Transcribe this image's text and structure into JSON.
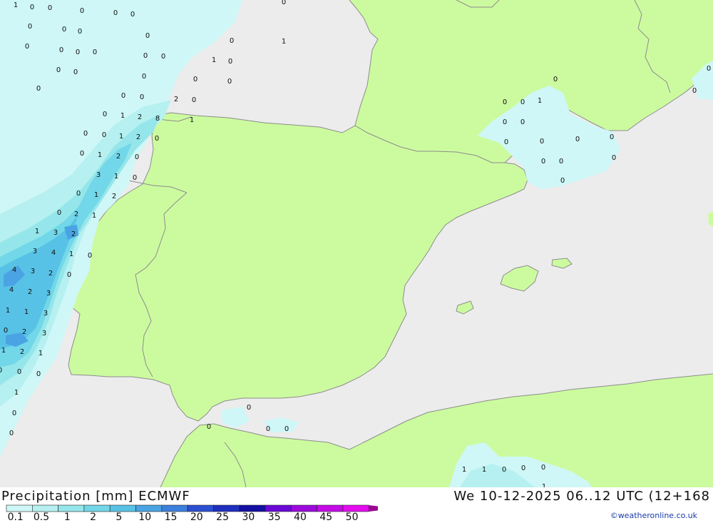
{
  "title": {
    "left": "Precipitation [mm] ECMWF",
    "right": "We 10-12-2025 06..12 UTC (12+168"
  },
  "credit": "©weatheronline.co.uk",
  "colors": {
    "sea": "#ececec",
    "land": "#ccfb9f",
    "border": "#8c8c8c"
  },
  "legend": {
    "colors": [
      "#cff7f7",
      "#b6f0f0",
      "#95e6ea",
      "#72d7e8",
      "#58c2e6",
      "#4aa4e3",
      "#3d7fdd",
      "#2b4fd0",
      "#1e2fc0",
      "#1310a3",
      "#6a08d8",
      "#9b0adc",
      "#c50ae8",
      "#e40cef",
      "#c80fb8",
      "#9a0893"
    ],
    "labels": [
      "0.1",
      "0.5",
      "1",
      "2",
      "5",
      "10",
      "15",
      "20",
      "25",
      "30",
      "35",
      "40",
      "45",
      "50"
    ]
  },
  "map_values": [
    [
      "1",
      22,
      6
    ],
    [
      "0",
      45,
      9
    ],
    [
      "0",
      70,
      10
    ],
    [
      "0",
      115,
      14
    ],
    [
      "0",
      162,
      17
    ],
    [
      "0",
      186,
      19
    ],
    [
      "0",
      398,
      2
    ],
    [
      "0",
      42,
      36
    ],
    [
      "0",
      90,
      40
    ],
    [
      "0",
      112,
      43
    ],
    [
      "0",
      207,
      49
    ],
    [
      "0",
      38,
      64
    ],
    [
      "0",
      86,
      69
    ],
    [
      "0",
      109,
      72
    ],
    [
      "0",
      133,
      72
    ],
    [
      "0",
      204,
      77
    ],
    [
      "0",
      229,
      78
    ],
    [
      "1",
      398,
      57
    ],
    [
      "0",
      325,
      56
    ],
    [
      "1",
      300,
      83
    ],
    [
      "0",
      323,
      85
    ],
    [
      "0",
      82,
      97
    ],
    [
      "0",
      106,
      100
    ],
    [
      "0",
      202,
      106
    ],
    [
      "0",
      274,
      110
    ],
    [
      "0",
      322,
      113
    ],
    [
      "0",
      54,
      123
    ],
    [
      "0",
      173,
      133
    ],
    [
      "0",
      199,
      135
    ],
    [
      "2",
      247,
      138
    ],
    [
      "0",
      272,
      139
    ],
    [
      "0",
      147,
      159
    ],
    [
      "1",
      172,
      161
    ],
    [
      "2",
      196,
      163
    ],
    [
      "8",
      221,
      165
    ],
    [
      "1",
      269,
      167
    ],
    [
      "0",
      120,
      186
    ],
    [
      "0",
      146,
      188
    ],
    [
      "1",
      170,
      190
    ],
    [
      "2",
      194,
      191
    ],
    [
      "0",
      220,
      193
    ],
    [
      "0",
      115,
      214
    ],
    [
      "1",
      140,
      216
    ],
    [
      "2",
      166,
      218
    ],
    [
      "0",
      192,
      219
    ],
    [
      "3",
      138,
      244
    ],
    [
      "1",
      163,
      246
    ],
    [
      "0",
      189,
      248
    ],
    [
      "0",
      110,
      270
    ],
    [
      "1",
      135,
      272
    ],
    [
      "2",
      160,
      274
    ],
    [
      "0",
      83,
      297
    ],
    [
      "2",
      107,
      299
    ],
    [
      "1",
      132,
      301
    ],
    [
      "1",
      52,
      323
    ],
    [
      "3",
      78,
      325
    ],
    [
      "2",
      103,
      327
    ],
    [
      "3",
      49,
      351
    ],
    [
      "4",
      75,
      353
    ],
    [
      "1",
      100,
      355
    ],
    [
      "0",
      126,
      357
    ],
    [
      "4",
      20,
      377
    ],
    [
      "3",
      46,
      379
    ],
    [
      "2",
      71,
      382
    ],
    [
      "0",
      97,
      384
    ],
    [
      "4",
      16,
      405
    ],
    [
      "2",
      42,
      408
    ],
    [
      "3",
      68,
      410
    ],
    [
      "1",
      11,
      434
    ],
    [
      "1",
      37,
      436
    ],
    [
      "3",
      64,
      438
    ],
    [
      "0",
      8,
      462
    ],
    [
      "2",
      34,
      464
    ],
    [
      "3",
      62,
      466
    ],
    [
      "1",
      5,
      490
    ],
    [
      "2",
      31,
      492
    ],
    [
      "1",
      57,
      494
    ],
    [
      "0",
      0,
      518
    ],
    [
      "0",
      27,
      520
    ],
    [
      "0",
      54,
      523
    ],
    [
      "1",
      23,
      549
    ],
    [
      "0",
      20,
      578
    ],
    [
      "0",
      16,
      606
    ],
    [
      "0",
      349,
      570
    ],
    [
      "0",
      293,
      597
    ],
    [
      "0",
      376,
      600
    ],
    [
      "0",
      402,
      600
    ],
    [
      "0",
      779,
      110
    ],
    [
      "0",
      708,
      142
    ],
    [
      "0",
      733,
      142
    ],
    [
      "1",
      757,
      140
    ],
    [
      "0",
      708,
      170
    ],
    [
      "0",
      733,
      170
    ],
    [
      "0",
      710,
      198
    ],
    [
      "0",
      760,
      197
    ],
    [
      "0",
      810,
      194
    ],
    [
      "0",
      858,
      191
    ],
    [
      "0",
      762,
      225
    ],
    [
      "0",
      787,
      225
    ],
    [
      "0",
      861,
      220
    ],
    [
      "0",
      789,
      252
    ],
    [
      "0",
      994,
      95
    ],
    [
      "0",
      974,
      126
    ],
    [
      "1",
      651,
      657
    ],
    [
      "1",
      679,
      657
    ],
    [
      "0",
      707,
      657
    ],
    [
      "0",
      734,
      655
    ],
    [
      "0",
      762,
      654
    ],
    [
      "1",
      763,
      681
    ]
  ]
}
